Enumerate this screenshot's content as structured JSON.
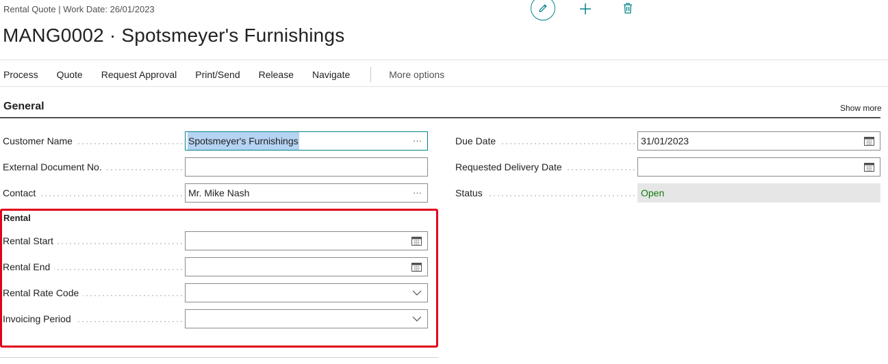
{
  "header": {
    "breadcrumb": "Rental Quote | Work Date: 26/01/2023",
    "title": "MANG0002 · Spotsmeyer's Furnishings"
  },
  "actions": {
    "edit_icon": "pencil-icon",
    "new_icon": "plus-icon",
    "delete_icon": "trash-icon"
  },
  "menu": {
    "items": [
      "Process",
      "Quote",
      "Request Approval",
      "Print/Send",
      "Release",
      "Navigate"
    ],
    "more": "More options"
  },
  "general": {
    "title": "General",
    "show_more": "Show more",
    "left_fields": [
      {
        "label": "Customer Name",
        "value": "Spotsmeyer's Furnishings",
        "aux": "ellipsis"
      },
      {
        "label": "External Document No.",
        "value": ""
      },
      {
        "label": "Contact",
        "value": "Mr. Mike Nash",
        "aux": "ellipsis"
      }
    ],
    "right_fields": [
      {
        "label": "Due Date",
        "value": "31/01/2023",
        "aux": "calendar"
      },
      {
        "label": "Requested Delivery Date",
        "value": "",
        "aux": "calendar"
      },
      {
        "label": "Status",
        "value": "Open"
      }
    ]
  },
  "rental": {
    "title": "Rental",
    "fields": [
      {
        "label": "Rental Start",
        "value": "",
        "aux": "calendar"
      },
      {
        "label": "Rental End",
        "value": "",
        "aux": "calendar"
      },
      {
        "label": "Rental Rate Code",
        "value": "",
        "aux": "dropdown"
      },
      {
        "label": "Invoicing Period",
        "value": "",
        "aux": "dropdown"
      }
    ]
  },
  "glyphs": {
    "ellipsis": "···"
  },
  "colors": {
    "accent": "#008489",
    "status_open": "#107c10",
    "highlight": "#e0001b",
    "selection": "#b5d3f3"
  }
}
